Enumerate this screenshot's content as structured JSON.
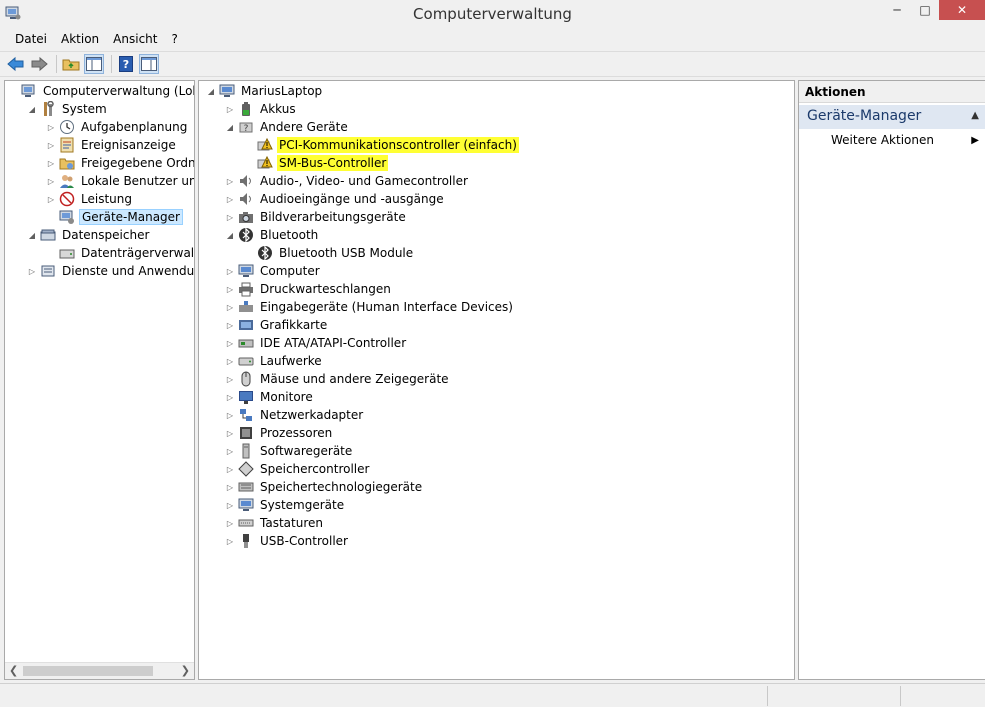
{
  "window": {
    "title": "Computerverwaltung"
  },
  "menu": [
    "Datei",
    "Aktion",
    "Ansicht",
    "?"
  ],
  "left_tree": [
    {
      "label": "Computerverwaltung (Lokal)",
      "depth": 0,
      "tw": "",
      "icon": "computer-management-icon"
    },
    {
      "label": "System",
      "depth": 1,
      "tw": "◢",
      "icon": "system-tools-icon"
    },
    {
      "label": "Aufgabenplanung",
      "depth": 2,
      "tw": "▷",
      "icon": "task-scheduler-icon"
    },
    {
      "label": "Ereignisanzeige",
      "depth": 2,
      "tw": "▷",
      "icon": "event-viewer-icon"
    },
    {
      "label": "Freigegebene Ordner",
      "depth": 2,
      "tw": "▷",
      "icon": "shared-folders-icon"
    },
    {
      "label": "Lokale Benutzer und Gru",
      "depth": 2,
      "tw": "▷",
      "icon": "local-users-icon"
    },
    {
      "label": "Leistung",
      "depth": 2,
      "tw": "▷",
      "icon": "performance-icon"
    },
    {
      "label": "Geräte-Manager",
      "depth": 2,
      "tw": "",
      "icon": "device-manager-icon",
      "selected": true
    },
    {
      "label": "Datenspeicher",
      "depth": 1,
      "tw": "◢",
      "icon": "storage-icon"
    },
    {
      "label": "Datenträgerverwaltung",
      "depth": 2,
      "tw": "",
      "icon": "disk-management-icon"
    },
    {
      "label": "Dienste und Anwendungen",
      "depth": 1,
      "tw": "▷",
      "icon": "services-icon"
    }
  ],
  "device_tree": [
    {
      "label": "MariusLaptop",
      "depth": 0,
      "tw": "◢",
      "icon": "computer-icon"
    },
    {
      "label": "Akkus",
      "depth": 1,
      "tw": "▷",
      "icon": "battery-icon"
    },
    {
      "label": "Andere Geräte",
      "depth": 1,
      "tw": "◢",
      "icon": "unknown-device-icon"
    },
    {
      "label": "PCI-Kommunikationscontroller (einfach)",
      "depth": 2,
      "tw": "",
      "icon": "warning-device-icon",
      "highlight": true
    },
    {
      "label": "SM-Bus-Controller",
      "depth": 2,
      "tw": "",
      "icon": "warning-device-icon",
      "highlight": true
    },
    {
      "label": "Audio-, Video- und Gamecontroller",
      "depth": 1,
      "tw": "▷",
      "icon": "speaker-icon"
    },
    {
      "label": "Audioeingänge und -ausgänge",
      "depth": 1,
      "tw": "▷",
      "icon": "speaker-icon"
    },
    {
      "label": "Bildverarbeitungsgeräte",
      "depth": 1,
      "tw": "▷",
      "icon": "camera-icon"
    },
    {
      "label": "Bluetooth",
      "depth": 1,
      "tw": "◢",
      "icon": "bluetooth-icon"
    },
    {
      "label": "Bluetooth USB Module",
      "depth": 2,
      "tw": "",
      "icon": "bluetooth-icon"
    },
    {
      "label": "Computer",
      "depth": 1,
      "tw": "▷",
      "icon": "computer-icon"
    },
    {
      "label": "Druckwarteschlangen",
      "depth": 1,
      "tw": "▷",
      "icon": "printer-icon"
    },
    {
      "label": "Eingabegeräte (Human Interface Devices)",
      "depth": 1,
      "tw": "▷",
      "icon": "hid-icon"
    },
    {
      "label": "Grafikkarte",
      "depth": 1,
      "tw": "▷",
      "icon": "display-adapter-icon"
    },
    {
      "label": "IDE ATA/ATAPI-Controller",
      "depth": 1,
      "tw": "▷",
      "icon": "ide-controller-icon"
    },
    {
      "label": "Laufwerke",
      "depth": 1,
      "tw": "▷",
      "icon": "disk-drive-icon"
    },
    {
      "label": "Mäuse und andere Zeigegeräte",
      "depth": 1,
      "tw": "▷",
      "icon": "mouse-icon"
    },
    {
      "label": "Monitore",
      "depth": 1,
      "tw": "▷",
      "icon": "monitor-icon"
    },
    {
      "label": "Netzwerkadapter",
      "depth": 1,
      "tw": "▷",
      "icon": "network-adapter-icon"
    },
    {
      "label": "Prozessoren",
      "depth": 1,
      "tw": "▷",
      "icon": "processor-icon"
    },
    {
      "label": "Softwaregeräte",
      "depth": 1,
      "tw": "▷",
      "icon": "software-device-icon"
    },
    {
      "label": "Speichercontroller",
      "depth": 1,
      "tw": "▷",
      "icon": "storage-controller-icon"
    },
    {
      "label": "Speichertechnologiegeräte",
      "depth": 1,
      "tw": "▷",
      "icon": "memory-tech-icon"
    },
    {
      "label": "Systemgeräte",
      "depth": 1,
      "tw": "▷",
      "icon": "system-device-icon"
    },
    {
      "label": "Tastaturen",
      "depth": 1,
      "tw": "▷",
      "icon": "keyboard-icon"
    },
    {
      "label": "USB-Controller",
      "depth": 1,
      "tw": "▷",
      "icon": "usb-icon"
    }
  ],
  "actions": {
    "header": "Aktionen",
    "section": "Geräte-Manager",
    "item": "Weitere Aktionen"
  },
  "colors": {
    "highlight": "#ffff33",
    "selection": "#cce8ff",
    "section_bg": "#dfe7f2"
  }
}
